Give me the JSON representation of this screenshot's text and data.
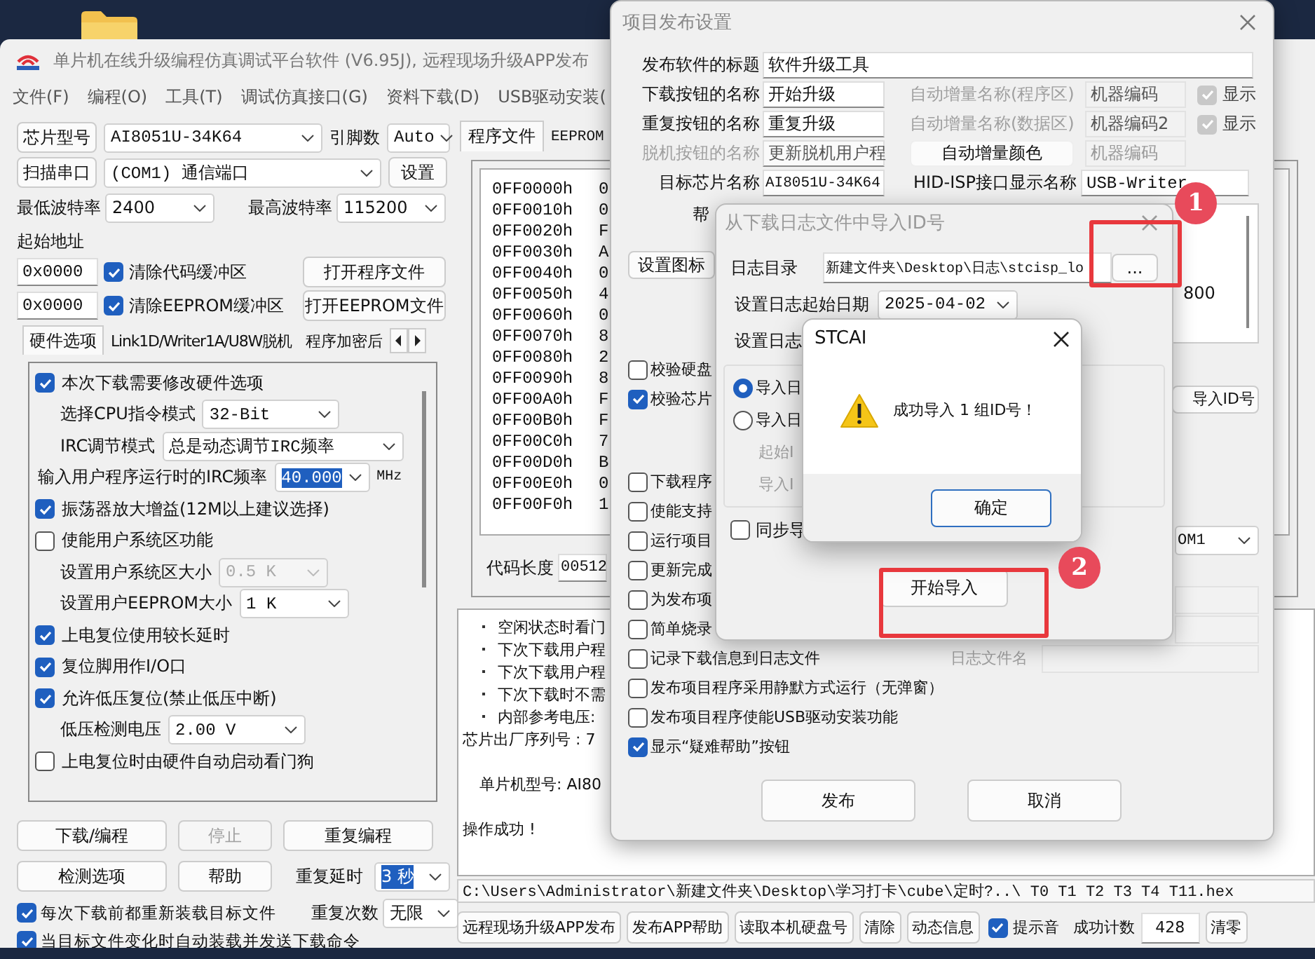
{
  "main_window": {
    "title": "单片机在线升级编程仿真调试平台软件 (V6.95J), 远程现场升级APP发布",
    "menu": [
      "文件(F)",
      "编程(O)",
      "工具(T)",
      "调试仿真接口(G)",
      "资料下载(D)",
      "USB驱动安装("
    ],
    "chip": {
      "button": "芯片型号",
      "value": "AI8051U-34K64",
      "pins_label": "引脚数",
      "pins_value": "Auto"
    },
    "port": {
      "button": "扫描串口",
      "value": "(COM1) 通信端口",
      "settings": "设置"
    },
    "min_baud": {
      "label": "最低波特率",
      "value": "2400"
    },
    "max_baud": {
      "label": "最高波特率",
      "value": "115200"
    },
    "start_address": {
      "label": "起始地址",
      "rows": [
        {
          "value": "0x0000",
          "checkbox": "清除代码缓冲区",
          "checked": true,
          "button": "打开程序文件"
        },
        {
          "value": "0x0000",
          "checkbox": "清除EEPROM缓冲区",
          "checked": true,
          "button": "打开EEPROM文件"
        }
      ]
    },
    "option_tabs": [
      {
        "label": "硬件选项",
        "selected": true
      },
      {
        "label": "Link1D/Writer1A/U8W脱机",
        "selected": false
      },
      {
        "label": "程序加密后",
        "selected": false
      }
    ],
    "hardware_options": [
      {
        "kind": "check",
        "label": "本次下载需要修改硬件选项",
        "checked": true
      },
      {
        "kind": "select",
        "label": "选择CPU指令模式",
        "value": "32-Bit",
        "disabled": false
      },
      {
        "kind": "select",
        "label": "IRC调节模式",
        "value": "总是动态调节IRC频率",
        "disabled": false
      },
      {
        "kind": "input",
        "label": "输入用户程序运行时的IRC频率",
        "value": "40.000",
        "unit": "MHz"
      },
      {
        "kind": "check",
        "label": "振荡器放大增益(12M以上建议选择)",
        "checked": true
      },
      {
        "kind": "check",
        "label": "使能用户系统区功能",
        "checked": false
      },
      {
        "kind": "select",
        "label": "设置用户系统区大小",
        "value": "0.5 K",
        "disabled": true
      },
      {
        "kind": "select",
        "label": "设置用户EEPROM大小",
        "value": "1   K",
        "disabled": false
      },
      {
        "kind": "check",
        "label": "上电复位使用较长延时",
        "checked": true
      },
      {
        "kind": "check",
        "label": "复位脚用作I/O口",
        "checked": true
      },
      {
        "kind": "check",
        "label": "允许低压复位(禁止低压中断)",
        "checked": true
      },
      {
        "kind": "select",
        "label": "低压检测电压",
        "value": "2.00 V",
        "disabled": false
      },
      {
        "kind": "check",
        "label": "上电复位时由硬件自动启动看门狗",
        "checked": false
      }
    ],
    "actions": [
      {
        "label": "下载/编程",
        "disabled": false
      },
      {
        "label": "停止",
        "disabled": true
      },
      {
        "label": "重复编程",
        "disabled": false
      },
      {
        "label": "检测选项",
        "disabled": false
      },
      {
        "label": "帮助",
        "disabled": false
      }
    ],
    "repeat_delay": {
      "label": "重复延时",
      "value": "3 秒"
    },
    "repeat_count": {
      "label": "重复次数",
      "value": "无限"
    },
    "auto_options": [
      {
        "label": "每次下载前都重新装载目标文件",
        "checked": true
      },
      {
        "label": "当目标文件变化时自动装载并发送下载命令",
        "checked": true
      }
    ],
    "file_tabs": [
      {
        "label": "程序文件",
        "selected": true
      },
      {
        "label": "EEPROM",
        "selected": false
      }
    ],
    "hex_rows": [
      {
        "address": "0FF0000h",
        "data": "0"
      },
      {
        "address": "0FF0010h",
        "data": "0"
      },
      {
        "address": "0FF0020h",
        "data": "F"
      },
      {
        "address": "0FF0030h",
        "data": "A"
      },
      {
        "address": "0FF0040h",
        "data": "0"
      },
      {
        "address": "0FF0050h",
        "data": "4"
      },
      {
        "address": "0FF0060h",
        "data": "0"
      },
      {
        "address": "0FF0070h",
        "data": "8"
      },
      {
        "address": "0FF0080h",
        "data": "2"
      },
      {
        "address": "0FF0090h",
        "data": "8"
      },
      {
        "address": "0FF00A0h",
        "data": "F"
      },
      {
        "address": "0FF00B0h",
        "data": "F"
      },
      {
        "address": "0FF00C0h",
        "data": "7"
      },
      {
        "address": "0FF00D0h",
        "data": "B"
      },
      {
        "address": "0FF00E0h",
        "data": "0"
      },
      {
        "address": "0FF00F0h",
        "data": "1"
      }
    ],
    "code_length": {
      "label": "代码长度",
      "value": "00512"
    },
    "log": [
      {
        "kind": "bullet",
        "text": "空闲状态时看门"
      },
      {
        "kind": "bullet",
        "text": "下次下载用户程"
      },
      {
        "kind": "bullet",
        "text": "下次下载用户程"
      },
      {
        "kind": "bullet",
        "text": "下次下载时不需"
      },
      {
        "kind": "bullet",
        "text": "内部参考电压:"
      },
      {
        "kind": "plain",
        "text": "芯片出厂序列号 : 7"
      },
      {
        "kind": "indent",
        "text": "单片机型号: AI80"
      },
      {
        "kind": "plain",
        "text": "操作成功 !"
      }
    ],
    "path": "C:\\Users\\Administrator\\新建文件夹\\Desktop\\学习打卡\\cube\\定时?..\\ T0 T1 T2 T3 T4 T11.hex",
    "bottom_buttons": [
      "远程现场升级APP发布",
      "发布APP帮助",
      "读取本机硬盘号",
      "清除",
      "动态信息"
    ],
    "beep": {
      "label": "提示音",
      "checked": true
    },
    "success_count": {
      "label": "成功计数",
      "value": "428"
    },
    "reset_button": "清零"
  },
  "publish_dialog": {
    "title": "项目发布设置",
    "fields": [
      {
        "label": "发布软件的标题",
        "value": "软件升级工具",
        "disabled": false
      },
      {
        "label": "下载按钮的名称",
        "value": "开始升级",
        "disabled": false
      },
      {
        "label": "重复按钮的名称",
        "value": "重复升级",
        "disabled": false
      },
      {
        "label": "脱机按钮的名称",
        "value": "更新脱机用户程",
        "disabled": true
      },
      {
        "label": "目标芯片名称",
        "value": "AI8051U-34K64",
        "disabled": false
      }
    ],
    "auto_fields": [
      {
        "label": "自动增量名称(程序区)",
        "value": "机器编码",
        "show": "显示",
        "checked": true
      },
      {
        "label": "自动增量名称(数据区)",
        "value": "机器编码2",
        "show": "显示",
        "checked": true
      }
    ],
    "color_button": "自动增量颜色",
    "color_sample": "机器编码",
    "hid_name": {
      "label": "HID-ISP接口显示名称",
      "value": "USB-Writer"
    },
    "help_label": "帮",
    "icon_button": "设置图标",
    "preview_text": "800",
    "options": [
      {
        "label": "校验硬盘",
        "checked": false
      },
      {
        "label": "校验芯片",
        "checked": true
      },
      {
        "label": "下载程序",
        "checked": false
      },
      {
        "label": "使能支持",
        "checked": false
      },
      {
        "label": "运行项目",
        "checked": false
      },
      {
        "label": "更新完成",
        "checked": false
      },
      {
        "label": "为发布项",
        "checked": false
      },
      {
        "label": "简单烧录",
        "checked": false
      },
      {
        "label": "记录下载信息到日志文件",
        "checked": false
      },
      {
        "label": "发布项目程序采用静默方式运行（无弹窗）",
        "checked": false
      },
      {
        "label": "发布项目程序使能USB驱动安装功能",
        "checked": false
      },
      {
        "label": "显示“疑难帮助”按钮",
        "checked": true
      }
    ],
    "import_id_button": "导入ID号",
    "port_combo": "OM1",
    "log_file_label": "日志文件名",
    "buttons": [
      "发布",
      "取消"
    ]
  },
  "import_dialog": {
    "title": "从下载日志文件中导入ID号",
    "dir": {
      "label": "日志目录",
      "value": "新建文件夹\\Desktop\\日志\\stcisp_lo",
      "browse": "..."
    },
    "start_date": {
      "label": "设置日志起始日期",
      "value": "2025-04-02"
    },
    "end_label": "设置日志",
    "modes": [
      {
        "label": "导入日",
        "selected": true
      },
      {
        "label": "导入日",
        "selected": false
      }
    ],
    "disabled_labels": [
      "起始I",
      "导入I"
    ],
    "sync": {
      "label": "同步导",
      "checked": false
    },
    "start_button": "开始导入"
  },
  "message_box": {
    "title": "STCAI",
    "text": "成功导入 1 组ID号！",
    "ok": "确定"
  },
  "annotations": [
    {
      "number": "1"
    },
    {
      "number": "2"
    }
  ]
}
